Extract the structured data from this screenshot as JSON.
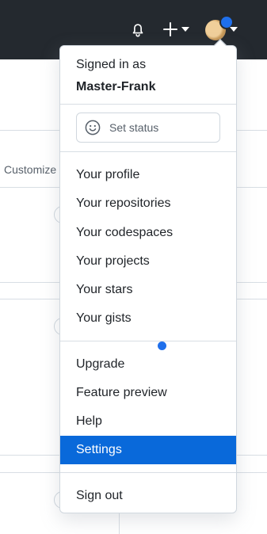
{
  "header": {
    "notifications_icon": "bell-icon",
    "create_icon": "plus-icon",
    "avatar_icon": "user-avatar"
  },
  "background": {
    "customize_label": "Customize"
  },
  "dropdown": {
    "signed_in_label": "Signed in as",
    "username": "Master-Frank",
    "set_status_label": "Set status",
    "section1": [
      "Your profile",
      "Your repositories",
      "Your codespaces",
      "Your projects",
      "Your stars",
      "Your gists"
    ],
    "section2": [
      "Upgrade",
      "Feature preview",
      "Help",
      "Settings"
    ],
    "sign_out_label": "Sign out",
    "active_item": "Settings"
  },
  "colors": {
    "header_bg": "#24292f",
    "accent": "#0969da",
    "badge_blue": "#1f6feb"
  }
}
